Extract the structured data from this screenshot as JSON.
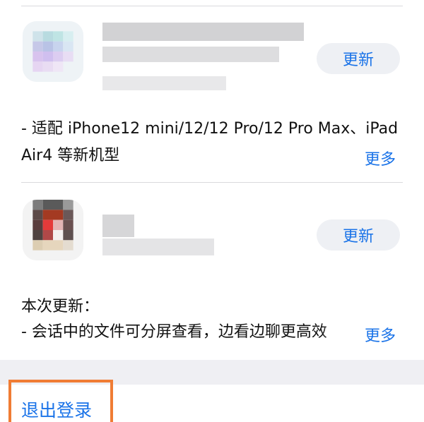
{
  "apps": [
    {
      "update_label": "更新",
      "notes_line1": "- 适配 iPhone12 mini/12/12 Pro/12 Pro Max、iPad",
      "notes_line2": "Air4 等新机型",
      "more_label": "更多"
    },
    {
      "update_label": "更新",
      "notes_line1": "本次更新：",
      "notes_line2": "- 会话中的文件可分屏查看，边看边聊更高效",
      "more_label": "更多"
    }
  ],
  "footer": {
    "logout_label": "退出登录"
  },
  "colors": {
    "accent": "#1a73e8",
    "highlight": "#f07c34",
    "background_band": "#efeff3"
  },
  "icons": [
    "app-icon-blurred",
    "app-icon-blurred"
  ]
}
